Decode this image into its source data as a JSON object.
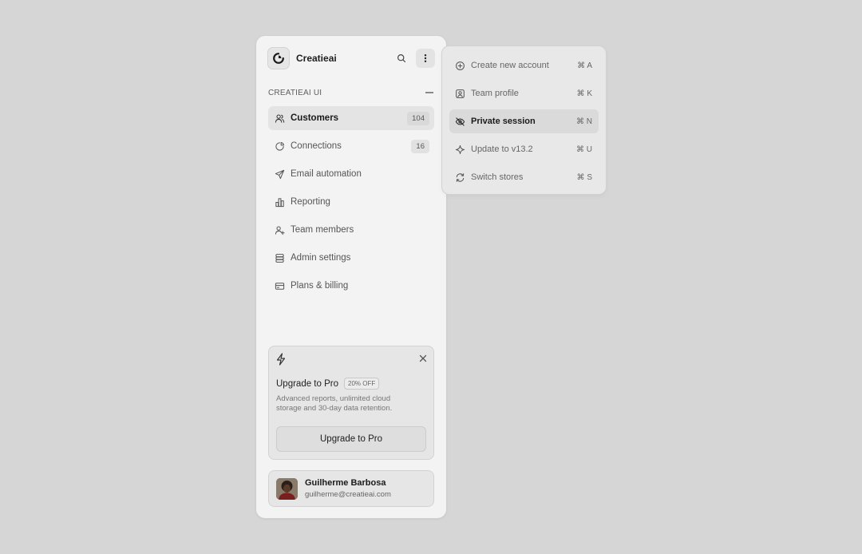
{
  "app": {
    "name": "Creatieai"
  },
  "section": {
    "title": "CREATIEAI UI"
  },
  "nav": [
    {
      "label": "Customers",
      "icon": "users-icon",
      "count": "104",
      "active": true
    },
    {
      "label": "Connections",
      "icon": "pie-chart-icon",
      "count": "16"
    },
    {
      "label": "Email automation",
      "icon": "send-icon"
    },
    {
      "label": "Reporting",
      "icon": "bar-chart-icon"
    },
    {
      "label": "Team members",
      "icon": "user-plus-icon"
    },
    {
      "label": "Admin settings",
      "icon": "database-icon"
    },
    {
      "label": "Plans & billing",
      "icon": "credit-card-icon"
    }
  ],
  "promo": {
    "title": "Upgrade to Pro",
    "badge": "20% OFF",
    "description": "Advanced reports, unlimited cloud storage and 30-day data retention.",
    "button": "Upgrade to Pro"
  },
  "user": {
    "name": "Guilherme Barbosa",
    "email": "guilherme@creatieai.com"
  },
  "menu": [
    {
      "label": "Create new account",
      "icon": "plus-circle-icon",
      "shortcut": "⌘ A"
    },
    {
      "label": "Team profile",
      "icon": "user-square-icon",
      "shortcut": "⌘ K"
    },
    {
      "label": "Private session",
      "icon": "eye-off-icon",
      "shortcut": "⌘ N",
      "active": true
    },
    {
      "label": "Update to v13.2",
      "icon": "sparkle-icon",
      "shortcut": "⌘ U"
    },
    {
      "label": "Switch stores",
      "icon": "refresh-icon",
      "shortcut": "⌘ S"
    }
  ]
}
